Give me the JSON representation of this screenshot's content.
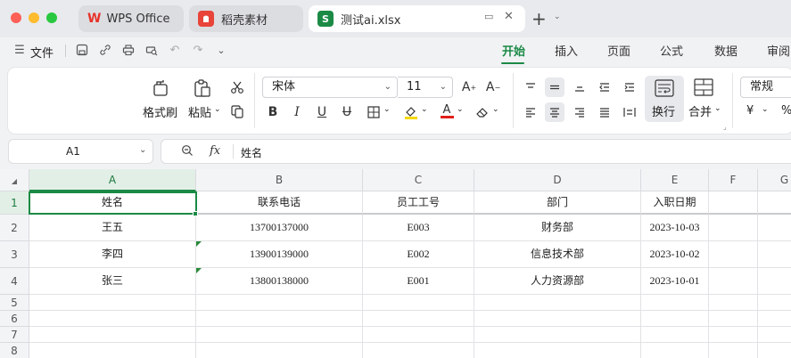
{
  "window": {
    "traffic_lights": [
      "#fe5f57",
      "#febc2e",
      "#28c840"
    ]
  },
  "tabs": [
    {
      "label": "WPS Office",
      "icon": "wps-logo-icon",
      "color": "#e8332a",
      "active": false
    },
    {
      "label": "稻壳素材",
      "icon": "docer-logo-icon",
      "color": "#e8443a",
      "active": false
    },
    {
      "label": "测试ai.xlsx",
      "icon": "spreadsheet-s-icon",
      "icon_text": "S",
      "color": "#1b8a45",
      "active": true
    }
  ],
  "menu": {
    "file_label": "文件",
    "ribbon_tabs": [
      "开始",
      "插入",
      "页面",
      "公式",
      "数据",
      "审阅"
    ],
    "active_tab": "开始",
    "accent": "#1b8a45"
  },
  "ribbon": {
    "format_painter": "格式刷",
    "paste": "粘贴",
    "font_name": "宋体",
    "font_size": "11",
    "wrap_text": "换行",
    "merge": "合并",
    "number_format": "常规",
    "currency_symbol": "¥",
    "percent_symbol": "%"
  },
  "formula_bar": {
    "cell_ref": "A1",
    "fx_label": "fx",
    "content": "姓名"
  },
  "sheet": {
    "columns": [
      "A",
      "B",
      "C",
      "D",
      "E",
      "F",
      "G"
    ],
    "selected_column": "A",
    "rows": [
      "1",
      "2",
      "3",
      "4",
      "5",
      "6",
      "7",
      "8"
    ],
    "header": [
      "姓名",
      "联系电话",
      "员工工号",
      "部门",
      "入职日期"
    ],
    "data": [
      [
        "王五",
        "13700137000",
        "E003",
        "财务部",
        "2023-10-03"
      ],
      [
        "李四",
        "13900139000",
        "E002",
        "信息技术部",
        "2023-10-02"
      ],
      [
        "张三",
        "13800138000",
        "E001",
        "人力资源部",
        "2023-10-01"
      ]
    ]
  }
}
